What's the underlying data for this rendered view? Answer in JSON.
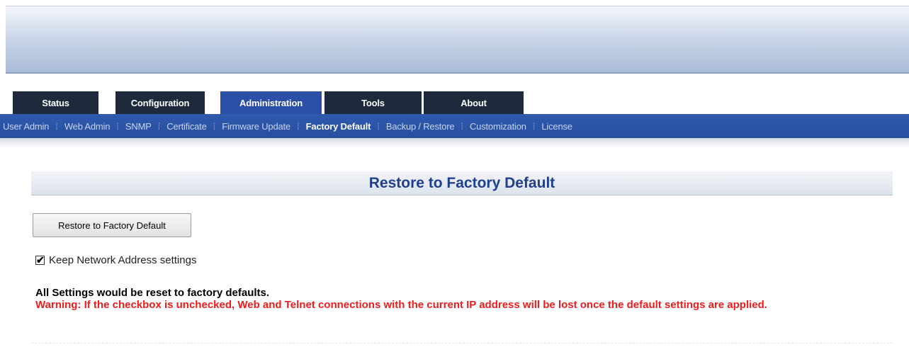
{
  "tabs": [
    {
      "label": "Status",
      "active": false
    },
    {
      "label": "Configuration",
      "active": false
    },
    {
      "label": "Administration",
      "active": true
    },
    {
      "label": "Tools",
      "active": false
    },
    {
      "label": "About",
      "active": false
    }
  ],
  "subnav": [
    {
      "label": "User Admin",
      "active": false
    },
    {
      "label": "Web Admin",
      "active": false
    },
    {
      "label": "SNMP",
      "active": false
    },
    {
      "label": "Certificate",
      "active": false
    },
    {
      "label": "Firmware Update",
      "active": false
    },
    {
      "label": "Factory Default",
      "active": true
    },
    {
      "label": "Backup / Restore",
      "active": false
    },
    {
      "label": "Customization",
      "active": false
    },
    {
      "label": "License",
      "active": false
    }
  ],
  "section": {
    "title": "Restore to Factory Default"
  },
  "restore_button": {
    "label": "Restore to Factory Default"
  },
  "keep_network": {
    "label": "Keep Network Address settings",
    "checked": true
  },
  "info": {
    "line1": "All Settings would be reset to factory defaults.",
    "warning": "Warning: If the checkbox is unchecked, Web and Telnet connections with the current IP address will be lost once the default settings are applied."
  },
  "colors": {
    "tab_bg": "#1e2a3c",
    "tab_active_bg": "#2b4fa6",
    "subnav_bg": "#274f9f",
    "title_color": "#1f3f8f",
    "warning_color": "#ee1c1c"
  }
}
